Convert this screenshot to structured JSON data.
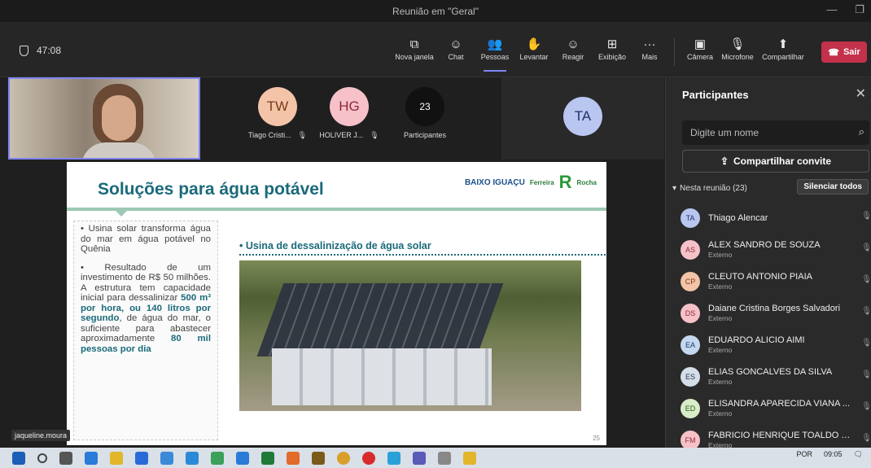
{
  "window": {
    "title": "Reunião em \"Geral\""
  },
  "toolbar": {
    "timer": "47:08",
    "buttons": [
      {
        "label": "Nova janela",
        "icon": "new-window-icon"
      },
      {
        "label": "Chat",
        "icon": "chat-icon"
      },
      {
        "label": "Pessoas",
        "icon": "people-icon"
      },
      {
        "label": "Levantar",
        "icon": "raise-hand-icon"
      },
      {
        "label": "Reagir",
        "icon": "react-icon"
      },
      {
        "label": "Exibição",
        "icon": "view-icon"
      },
      {
        "label": "Mais",
        "icon": "more-icon"
      },
      {
        "label": "Câmera",
        "icon": "camera-off-icon"
      },
      {
        "label": "Microfone",
        "icon": "mic-off-icon"
      },
      {
        "label": "Compartilhar",
        "icon": "share-icon"
      }
    ],
    "leave_label": "Sair"
  },
  "stage": {
    "tiles": [
      {
        "initials": "TW",
        "name": "Tiago Cristi...",
        "color": "#f3c4a8",
        "text_color": "#7a3a1a"
      },
      {
        "initials": "HG",
        "name": "HOLIVER J...",
        "color": "#f6c1c8",
        "text_color": "#8a2a3a"
      },
      {
        "initials": "23",
        "name": "Participantes",
        "color": "#111111",
        "text_color": "#ffffff"
      }
    ],
    "ta_tile": {
      "initials": "TA",
      "color": "#b8c6f0",
      "text_color": "#203070"
    },
    "self_name": "jaqueline.moura"
  },
  "slide": {
    "title": "Soluções para água potável",
    "logo1": "BAIXO IGUAÇU",
    "logo2a": "Ferreira",
    "logo2b": "Rocha",
    "bullet1": "Usina solar transforma água do mar em água potável no Quênia",
    "bullet2_a": "Resultado de um investimento de R$ 50 milhões. A estrutura tem capacidade inicial para dessalinizar",
    "bullet2_hl1": "500 m³ por hora, ou 140 litros por segundo",
    "bullet2_b": ", de água do mar, o suficiente para abastecer aproximadamente",
    "bullet2_hl2": "80 mil pessoas por dia",
    "subtitle": "Usina de dessalinização de água solar",
    "page": "25"
  },
  "panel": {
    "title": "Participantes",
    "search_placeholder": "Digite um nome",
    "share_label": "Compartilhar convite",
    "section_label": "Nesta reunião (23)",
    "mute_all": "Silenciar todos",
    "participants": [
      {
        "initials": "TA",
        "name": "Thiago Alencar",
        "sub": "",
        "color": "#b8c6f0",
        "tcolor": "#203070"
      },
      {
        "initials": "AS",
        "name": "ALEX SANDRO DE SOUZA",
        "sub": "Externo",
        "color": "#f6c1c8",
        "tcolor": "#8a2a3a"
      },
      {
        "initials": "CP",
        "name": "CLEUTO ANTONIO PIAIA",
        "sub": "Externo",
        "color": "#f3c4a8",
        "tcolor": "#7a3a1a"
      },
      {
        "initials": "DS",
        "name": "Daiane Cristina Borges Salvadori",
        "sub": "Externo",
        "color": "#f6c1c8",
        "tcolor": "#8a2a3a"
      },
      {
        "initials": "EA",
        "name": "EDUARDO ALICIO AIMI",
        "sub": "Externo",
        "color": "#c4d8f0",
        "tcolor": "#1a3a6a"
      },
      {
        "initials": "ES",
        "name": "ELIAS GONCALVES DA SILVA",
        "sub": "Externo",
        "color": "#d4dde8",
        "tcolor": "#2a3a4a"
      },
      {
        "initials": "ED",
        "name": "ELISANDRA APARECIDA VIANA ...",
        "sub": "Externo",
        "color": "#d8ecc8",
        "tcolor": "#2a5a1a"
      },
      {
        "initials": "FM",
        "name": "FABRICIO HENRIQUE TOALDO M...",
        "sub": "Externo",
        "color": "#f6c1c8",
        "tcolor": "#8a2a3a"
      }
    ]
  },
  "taskbar": {
    "lang": "POR",
    "time": "09:05"
  }
}
